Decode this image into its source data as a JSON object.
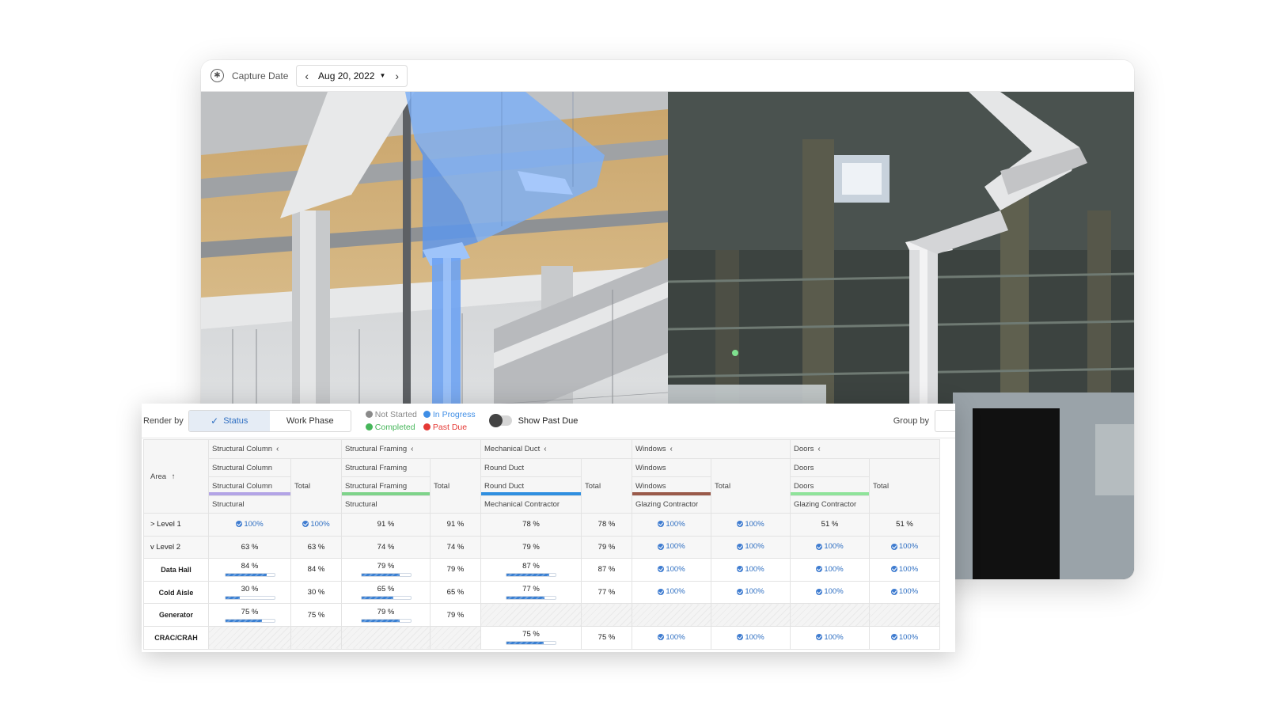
{
  "viewer": {
    "capture_label": "Capture Date",
    "date": "Aug 20, 2022",
    "prev_icon": "chevron-left-icon",
    "next_icon": "chevron-right-icon"
  },
  "controls": {
    "render_by_label": "Render by",
    "render_options": [
      "Status",
      "Work Phase"
    ],
    "active_render": "Status",
    "legend": [
      {
        "label": "Not Started",
        "color": "#8a8a8a"
      },
      {
        "label": "In Progress",
        "color": "#3f8ee6"
      },
      {
        "label": "Completed",
        "color": "#46b65a"
      },
      {
        "label": "Past Due",
        "color": "#e53935"
      }
    ],
    "show_past_due_label": "Show Past Due",
    "show_past_due": false,
    "group_by_label": "Group by"
  },
  "table": {
    "area_header": "Area",
    "sort_icon": "arrow-up-icon",
    "total_label": "Total",
    "groups": [
      {
        "name": "Structural Column",
        "sub": "Structural Column",
        "trade": "Structural Column",
        "contractor": "Structural",
        "color": "#b3a4e6"
      },
      {
        "name": "Structural Framing",
        "sub": "Structural Framing",
        "trade": "Structural Framing",
        "contractor": "Structural",
        "color": "#7ed38a"
      },
      {
        "name": "Mechanical Duct",
        "sub": "Round Duct",
        "trade": "Round Duct",
        "contractor": "Mechanical Contractor",
        "color": "#2f8fe0"
      },
      {
        "name": "Windows",
        "sub": "Windows",
        "trade": "Windows",
        "contractor": "Glazing Contractor",
        "color": "#9a5a4a"
      },
      {
        "name": "Doors",
        "sub": "Doors",
        "trade": "Doors",
        "contractor": "Glazing Contractor",
        "color": "#8fe39a"
      }
    ],
    "rows": [
      {
        "name": "> Level 1",
        "kind": "level",
        "cells": [
          {
            "v": "100%",
            "t": "done"
          },
          {
            "v": "100%",
            "t": "done"
          },
          {
            "v": "91 %"
          },
          {
            "v": "91 %"
          },
          {
            "v": "78 %"
          },
          {
            "v": "78 %"
          },
          {
            "v": "100%",
            "t": "done"
          },
          {
            "v": "100%",
            "t": "done"
          },
          {
            "v": "51 %"
          },
          {
            "v": "51 %"
          }
        ]
      },
      {
        "name": "v Level 2",
        "kind": "level",
        "cells": [
          {
            "v": "63 %"
          },
          {
            "v": "63 %"
          },
          {
            "v": "74 %"
          },
          {
            "v": "74 %"
          },
          {
            "v": "79 %"
          },
          {
            "v": "79 %"
          },
          {
            "v": "100%",
            "t": "done"
          },
          {
            "v": "100%",
            "t": "done"
          },
          {
            "v": "100%",
            "t": "done"
          },
          {
            "v": "100%",
            "t": "done"
          }
        ]
      },
      {
        "name": "Data Hall",
        "kind": "child",
        "cells": [
          {
            "v": "84 %",
            "t": "bar",
            "p": 0.84
          },
          {
            "v": "84 %"
          },
          {
            "v": "79 %",
            "t": "bar",
            "p": 0.79
          },
          {
            "v": "79 %"
          },
          {
            "v": "87 %",
            "t": "bar",
            "p": 0.87
          },
          {
            "v": "87 %"
          },
          {
            "v": "100%",
            "t": "done"
          },
          {
            "v": "100%",
            "t": "done"
          },
          {
            "v": "100%",
            "t": "done"
          },
          {
            "v": "100%",
            "t": "done"
          }
        ]
      },
      {
        "name": "Cold Aisle",
        "kind": "child",
        "cells": [
          {
            "v": "30 %",
            "t": "bar",
            "p": 0.3
          },
          {
            "v": "30 %"
          },
          {
            "v": "65 %",
            "t": "bar",
            "p": 0.65
          },
          {
            "v": "65 %"
          },
          {
            "v": "77 %",
            "t": "bar",
            "p": 0.77
          },
          {
            "v": "77 %"
          },
          {
            "v": "100%",
            "t": "done"
          },
          {
            "v": "100%",
            "t": "done"
          },
          {
            "v": "100%",
            "t": "done"
          },
          {
            "v": "100%",
            "t": "done"
          }
        ]
      },
      {
        "name": "Generator",
        "kind": "child",
        "cells": [
          {
            "v": "75 %",
            "t": "bar",
            "p": 0.75
          },
          {
            "v": "75 %"
          },
          {
            "v": "79 %",
            "t": "bar",
            "p": 0.79
          },
          {
            "v": "79 %"
          },
          {
            "t": "empty"
          },
          {
            "t": "empty"
          },
          {
            "t": "empty"
          },
          {
            "t": "empty"
          },
          {
            "t": "empty"
          },
          {
            "t": "empty"
          }
        ]
      },
      {
        "name": "CRAC/CRAH",
        "kind": "child",
        "cells": [
          {
            "t": "empty"
          },
          {
            "t": "empty"
          },
          {
            "t": "empty"
          },
          {
            "t": "empty"
          },
          {
            "v": "75 %",
            "t": "bar",
            "p": 0.75
          },
          {
            "v": "75 %"
          },
          {
            "v": "100%",
            "t": "done"
          },
          {
            "v": "100%",
            "t": "done"
          },
          {
            "v": "100%",
            "t": "done"
          },
          {
            "v": "100%",
            "t": "done"
          }
        ]
      }
    ]
  }
}
